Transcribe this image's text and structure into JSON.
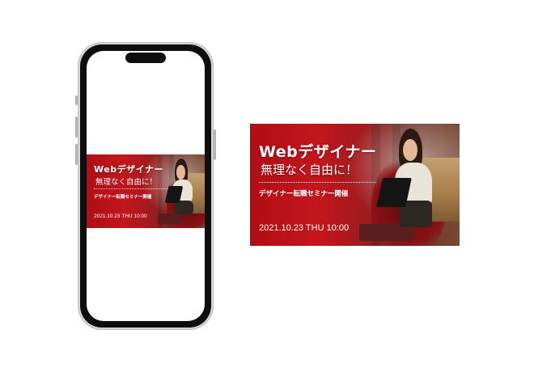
{
  "banner": {
    "title": "Webデザイナー",
    "subtitle": "無理なく自由に！",
    "caption": "デザイナー転職セミナー開催",
    "date": "2021.10.23 THU 10:00"
  },
  "colors": {
    "accent_red": "#c3161d",
    "phone_frame": "#0e0e0e"
  }
}
